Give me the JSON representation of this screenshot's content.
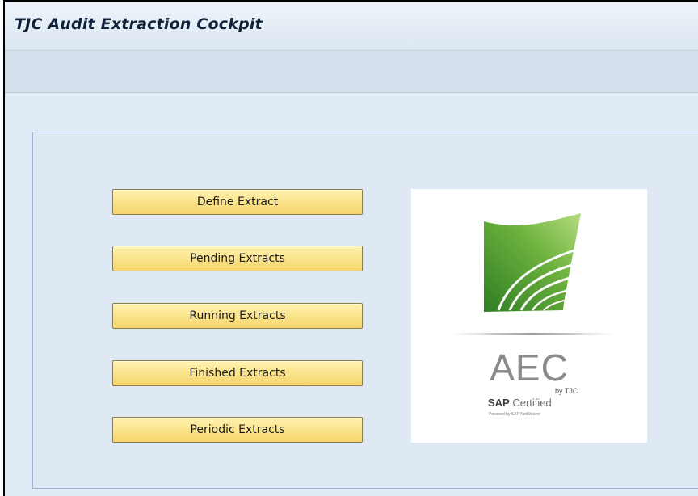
{
  "header": {
    "title": "TJC Audit Extraction Cockpit"
  },
  "buttons": [
    {
      "label": "Define Extract"
    },
    {
      "label": "Pending Extracts"
    },
    {
      "label": "Running Extracts"
    },
    {
      "label": "Finished Extracts"
    },
    {
      "label": "Periodic Extracts"
    }
  ],
  "logo": {
    "name": "AEC",
    "byline": "by TJC",
    "cert_brand": "SAP",
    "cert_text": "Certified",
    "powered_by": "Powered by SAP NetWeaver",
    "colors": {
      "leaf_dark": "#3e8a2a",
      "leaf_light": "#a6d16a",
      "text_gray": "#8a8a8a"
    }
  },
  "colors": {
    "button_fill": "#fae288",
    "background": "#e1ebf5",
    "title_text": "#10233a"
  }
}
